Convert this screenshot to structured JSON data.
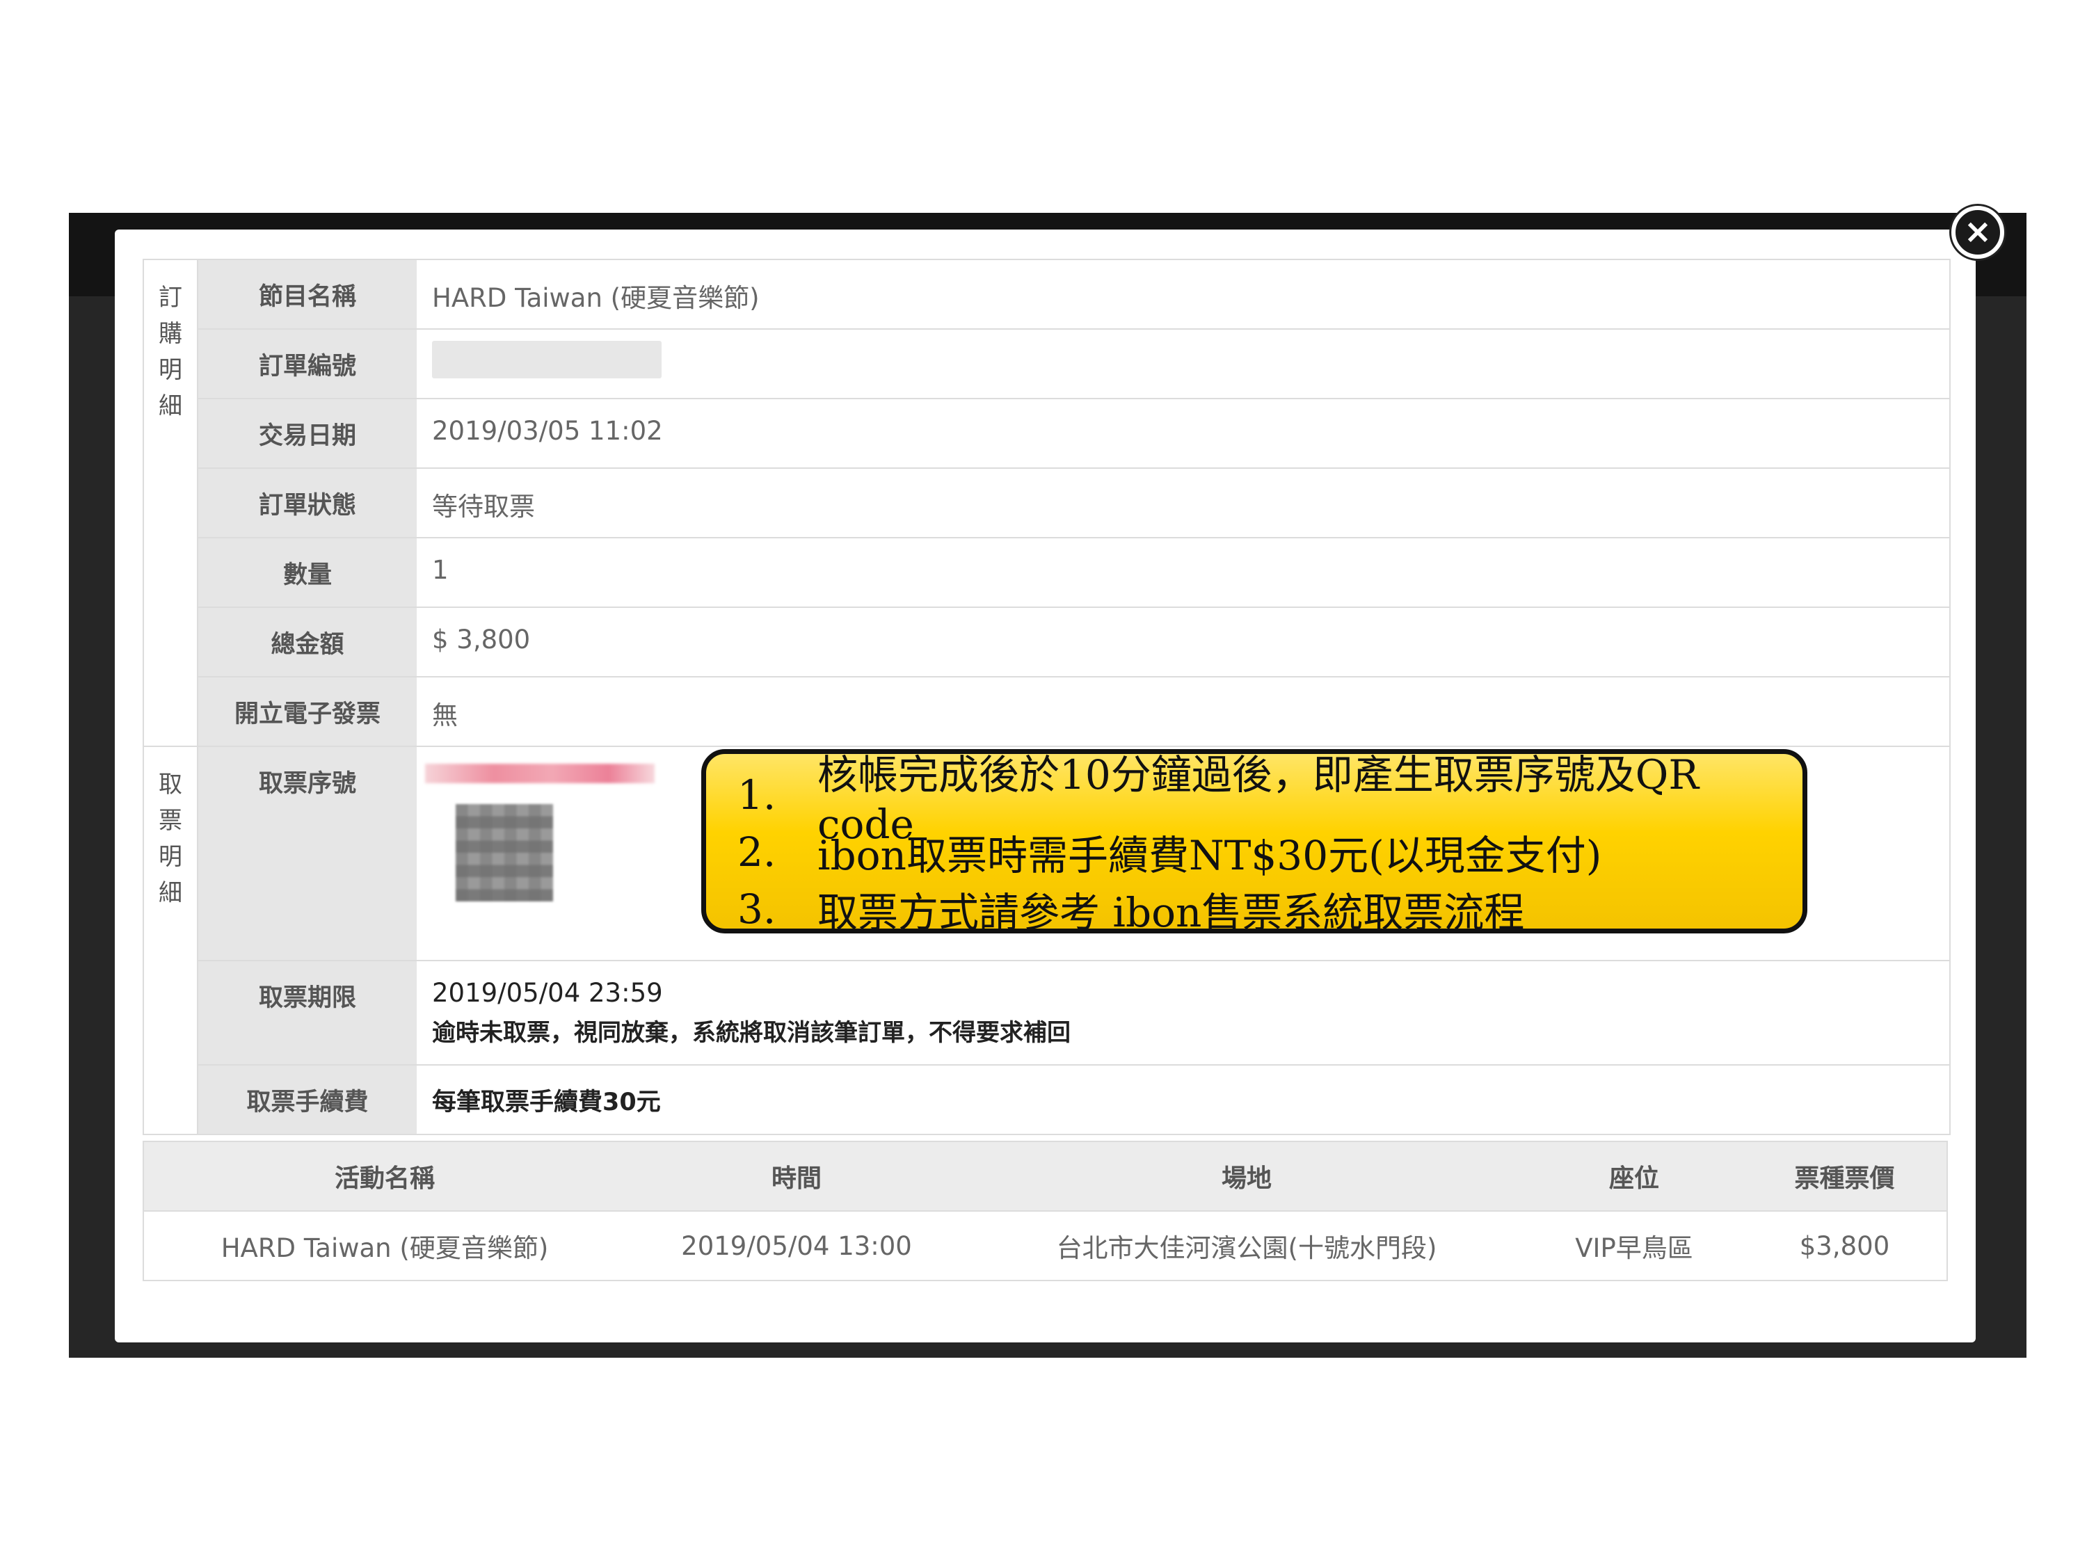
{
  "close_glyph": "×",
  "order": {
    "group_label": "訂購明細",
    "rows": [
      {
        "label": "節目名稱",
        "value": "HARD Taiwan (硬夏音樂節)"
      },
      {
        "label": "訂單編號",
        "value": ""
      },
      {
        "label": "交易日期",
        "value": "2019/03/05 11:02"
      },
      {
        "label": "訂單狀態",
        "value": "等待取票"
      },
      {
        "label": "數量",
        "value": "1"
      },
      {
        "label": "總金額",
        "value": "$ 3,800"
      },
      {
        "label": "開立電子發票",
        "value": "無"
      }
    ]
  },
  "pickup": {
    "group_label": "取票明細",
    "serial_label": "取票序號",
    "deadline_label": "取票期限",
    "deadline_value": "2019/05/04 23:59",
    "deadline_note": "逾時未取票，視同放棄，系統將取消該筆訂單，不得要求補回",
    "fee_label": "取票手續費",
    "fee_value": "每筆取票手續費30元"
  },
  "callout": {
    "items": [
      {
        "num": "1.",
        "text": "核帳完成後於10分鐘過後，即產生取票序號及QR code"
      },
      {
        "num": "2.",
        "text": "ibon取票時需手續費NT$30元(以現金支付)"
      },
      {
        "num": "3.",
        "text": "取票方式請參考 ibon售票系統取票流程"
      }
    ],
    "color": "#ffd200"
  },
  "event_table": {
    "headers": [
      "活動名稱",
      "時間",
      "場地",
      "座位",
      "票種票價"
    ],
    "rows": [
      [
        "HARD Taiwan (硬夏音樂節)",
        "2019/05/04 13:00",
        "台北市大佳河濱公園(十號水門段)",
        "VIP早鳥區",
        "$3,800"
      ]
    ]
  }
}
